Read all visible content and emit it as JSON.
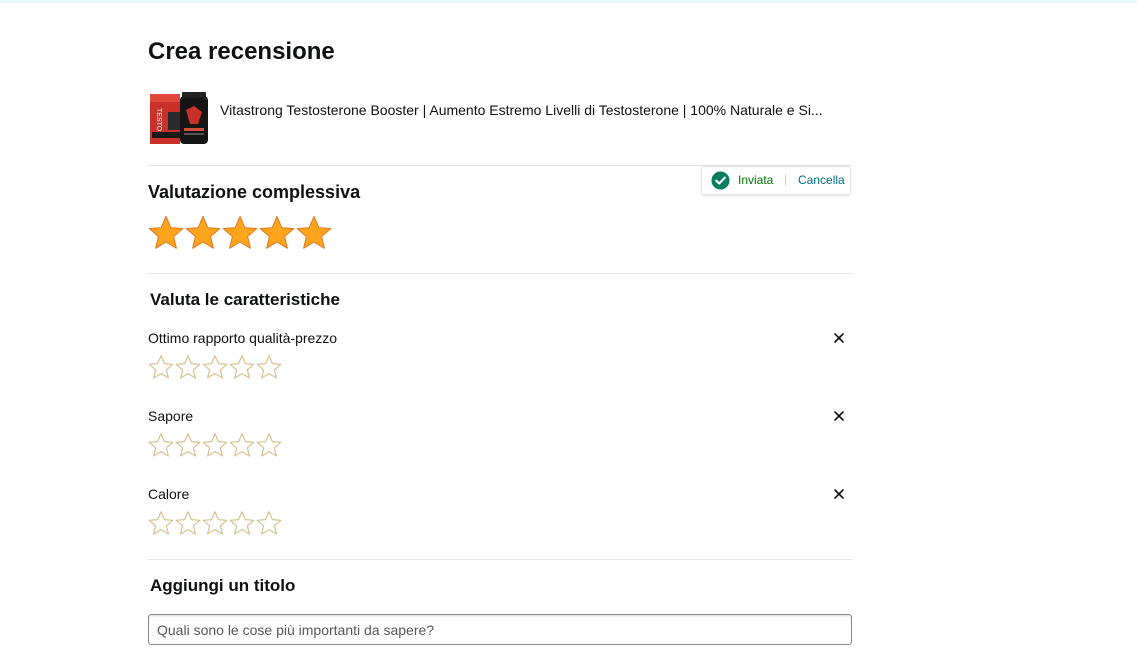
{
  "page": {
    "title": "Crea recensione"
  },
  "product": {
    "title": "Vitastrong Testosterone Booster | Aumento Estremo Livelli di Testosterone | 100% Naturale e Si...",
    "image_icon": "product-thumbnail"
  },
  "overall_rating": {
    "heading": "Valutazione complessiva",
    "value": 5,
    "max": 5,
    "status": {
      "submitted_label": "Inviata",
      "separator": "|",
      "cancel_label": "Cancella"
    }
  },
  "features": {
    "heading": "Valuta le caratteristiche",
    "items": [
      {
        "label": "Ottimo rapporto qualità-prezzo",
        "rating": 0,
        "max": 5
      },
      {
        "label": "Sapore",
        "rating": 0,
        "max": 5
      },
      {
        "label": "Calore",
        "rating": 0,
        "max": 5
      }
    ],
    "close_icon": "close-icon"
  },
  "headline": {
    "heading": "Aggiungi un titolo",
    "placeholder": "Quali sono le cose più importanti da sapere?",
    "value": ""
  },
  "colors": {
    "star_fill": "#ffa41c",
    "star_outline": "#de7921",
    "empty_star_outline": "#d8c090",
    "success_green": "#067d62",
    "link": "#007185"
  }
}
